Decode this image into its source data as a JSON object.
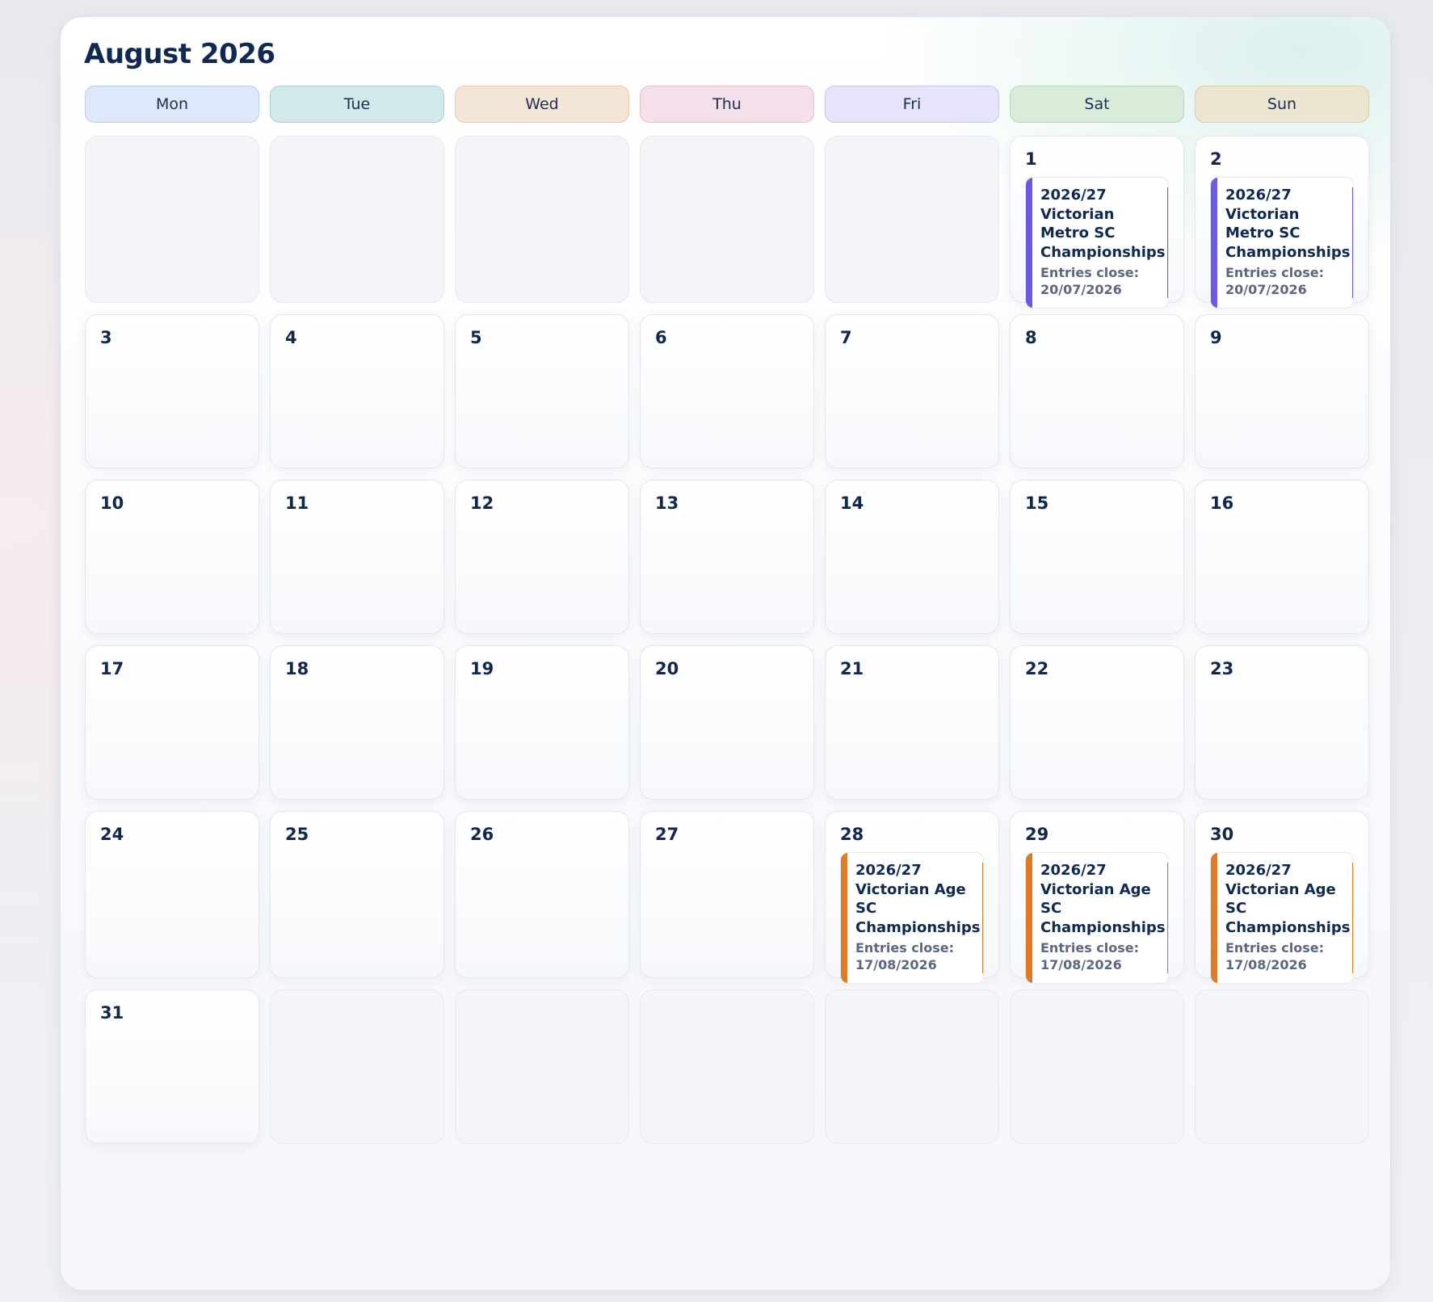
{
  "calendar": {
    "month_title": "August 2026",
    "weekdays": [
      {
        "label": "Mon",
        "bg": "#dde8fa",
        "border": "#b8cdee"
      },
      {
        "label": "Tue",
        "bg": "#d3e8e8",
        "border": "#a9d0cf"
      },
      {
        "label": "Wed",
        "bg": "#f4e6d6",
        "border": "#e8cba8"
      },
      {
        "label": "Thu",
        "bg": "#f4e0ea",
        "border": "#e6bfd2"
      },
      {
        "label": "Fri",
        "bg": "#e6e4fb",
        "border": "#c9c5f1"
      },
      {
        "label": "Sat",
        "bg": "#d9ecd9",
        "border": "#b4d8b5"
      },
      {
        "label": "Sun",
        "bg": "#ece5d2",
        "border": "#dacfa8"
      }
    ],
    "weeks": [
      [
        {
          "day": null
        },
        {
          "day": null
        },
        {
          "day": null
        },
        {
          "day": null
        },
        {
          "day": null
        },
        {
          "day": "1",
          "events": [
            {
              "title": "2026/27 Victorian Metro SC Championships",
              "close": "Entries close: 20/07/2026",
              "color": "#6a5be6"
            }
          ]
        },
        {
          "day": "2",
          "events": [
            {
              "title": "2026/27 Victorian Metro SC Championships",
              "close": "Entries close: 20/07/2026",
              "color": "#6a5be6"
            }
          ]
        }
      ],
      [
        {
          "day": "3"
        },
        {
          "day": "4"
        },
        {
          "day": "5"
        },
        {
          "day": "6"
        },
        {
          "day": "7"
        },
        {
          "day": "8"
        },
        {
          "day": "9"
        }
      ],
      [
        {
          "day": "10"
        },
        {
          "day": "11"
        },
        {
          "day": "12"
        },
        {
          "day": "13"
        },
        {
          "day": "14"
        },
        {
          "day": "15"
        },
        {
          "day": "16"
        }
      ],
      [
        {
          "day": "17"
        },
        {
          "day": "18"
        },
        {
          "day": "19"
        },
        {
          "day": "20"
        },
        {
          "day": "21"
        },
        {
          "day": "22"
        },
        {
          "day": "23"
        }
      ],
      [
        {
          "day": "24"
        },
        {
          "day": "25"
        },
        {
          "day": "26"
        },
        {
          "day": "27"
        },
        {
          "day": "28",
          "events": [
            {
              "title": "2026/27 Victorian Age SC Championships",
              "close": "Entries close: 17/08/2026",
              "color": "#e07b25"
            }
          ]
        },
        {
          "day": "29",
          "events": [
            {
              "title": "2026/27 Victorian Age SC Championships",
              "close": "Entries close: 17/08/2026",
              "color": "#e07b25"
            }
          ]
        },
        {
          "day": "30",
          "events": [
            {
              "title": "2026/27 Victorian Age SC Championships",
              "close": "Entries close: 17/08/2026",
              "color": "#e07b25"
            }
          ]
        }
      ],
      [
        {
          "day": "31"
        },
        {
          "day": null
        },
        {
          "day": null
        },
        {
          "day": null
        },
        {
          "day": null
        },
        {
          "day": null
        },
        {
          "day": null
        }
      ]
    ]
  }
}
